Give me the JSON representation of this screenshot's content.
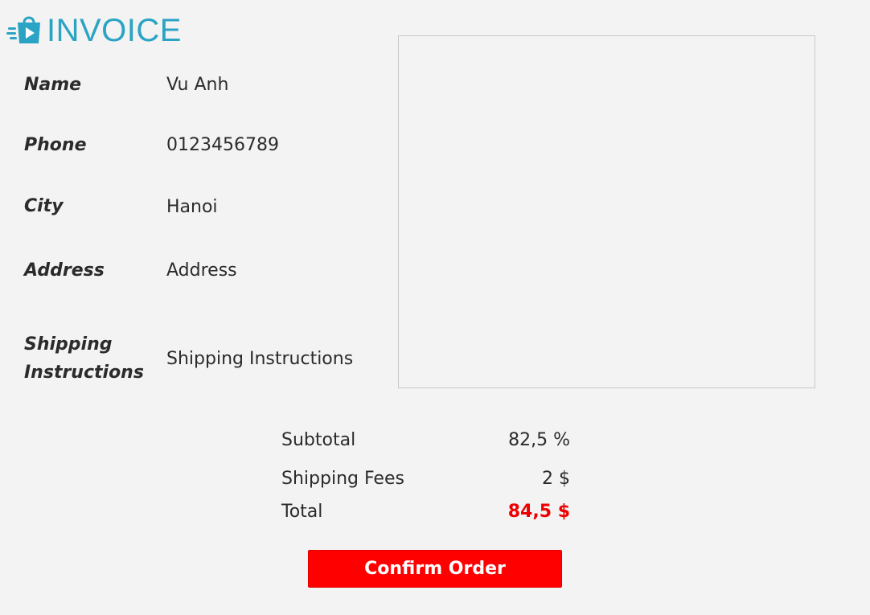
{
  "header": {
    "title": "INVOICE",
    "logo_icon": "shopping-bag-play-icon",
    "accent_color": "#2ba3c4"
  },
  "form": {
    "fields": [
      {
        "label": "Name",
        "value": "Vu Anh"
      },
      {
        "label": "Phone",
        "value": "0123456789"
      },
      {
        "label": "City",
        "value": "Hanoi"
      },
      {
        "label": "Address",
        "value": "Address"
      },
      {
        "label_line1": "Shipping",
        "label_line2": "Instructions",
        "value": "Shipping Instructions"
      }
    ]
  },
  "summary": {
    "subtotal_label": "Subtotal",
    "subtotal_value": "82,5 %",
    "shipping_label": "Shipping Fees",
    "shipping_value": "2 $",
    "total_label": "Total",
    "total_value": "84,5 $",
    "total_color": "#ee0000"
  },
  "actions": {
    "confirm_label": "Confirm Order",
    "confirm_color": "#ff0000"
  }
}
